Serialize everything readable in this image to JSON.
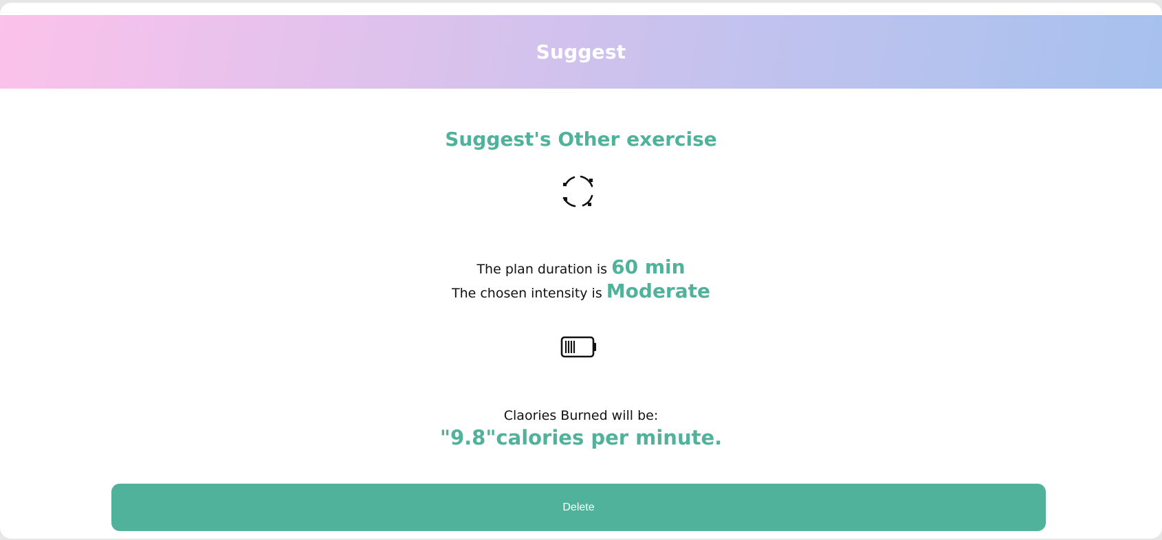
{
  "header": {
    "title": "Suggest"
  },
  "main": {
    "subtitle": "Suggest's Other exercise",
    "exercise_icon": "rotate-circle-icon",
    "duration": {
      "prefix": "The plan duration is",
      "value": "60 min"
    },
    "intensity": {
      "prefix": "The chosen intensity is",
      "value": "Moderate"
    },
    "energy_icon": "battery-icon",
    "calories": {
      "label": "Claories Burned will be:",
      "value": "\"9.8\"calories per minute."
    }
  },
  "actions": {
    "delete_label": "Delete"
  },
  "colors": {
    "accent": "#50b29b",
    "header_gradient_start": "#fbc2eb",
    "header_gradient_end": "#a6c1ee"
  }
}
